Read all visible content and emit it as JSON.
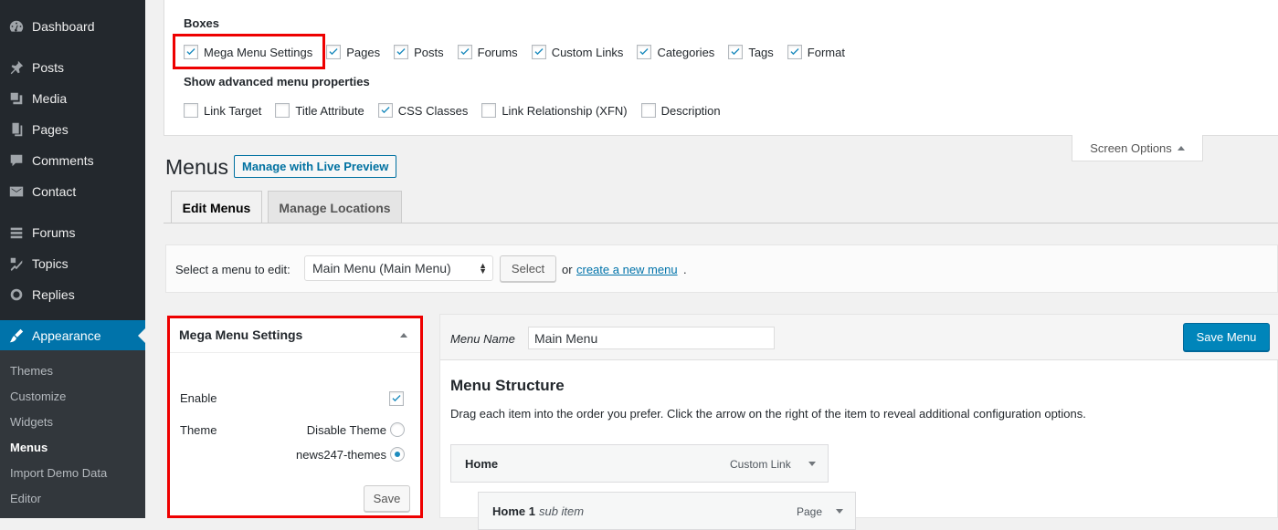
{
  "sidebar": {
    "items": [
      {
        "label": "Dashboard",
        "icon": "dashboard-icon"
      },
      {
        "label": "Posts",
        "icon": "pin-icon"
      },
      {
        "label": "Media",
        "icon": "media-icon"
      },
      {
        "label": "Pages",
        "icon": "pages-icon"
      },
      {
        "label": "Comments",
        "icon": "comment-icon"
      },
      {
        "label": "Contact",
        "icon": "mail-icon"
      },
      {
        "label": "Forums",
        "icon": "forums-icon"
      },
      {
        "label": "Topics",
        "icon": "topics-icon"
      },
      {
        "label": "Replies",
        "icon": "replies-icon"
      },
      {
        "label": "Appearance",
        "icon": "brush-icon"
      }
    ],
    "submenu": [
      "Themes",
      "Customize",
      "Widgets",
      "Menus",
      "Import Demo Data",
      "Editor"
    ],
    "current_submenu": "Menus"
  },
  "screen_options": {
    "boxes_title": "Boxes",
    "boxes": [
      {
        "label": "Mega Menu Settings",
        "checked": true
      },
      {
        "label": "Pages",
        "checked": true
      },
      {
        "label": "Posts",
        "checked": true
      },
      {
        "label": "Forums",
        "checked": true
      },
      {
        "label": "Custom Links",
        "checked": true
      },
      {
        "label": "Categories",
        "checked": true
      },
      {
        "label": "Tags",
        "checked": true
      },
      {
        "label": "Format",
        "checked": true
      }
    ],
    "advanced_title": "Show advanced menu properties",
    "advanced": [
      {
        "label": "Link Target",
        "checked": false
      },
      {
        "label": "Title Attribute",
        "checked": false
      },
      {
        "label": "CSS Classes",
        "checked": true
      },
      {
        "label": "Link Relationship (XFN)",
        "checked": false
      },
      {
        "label": "Description",
        "checked": false
      }
    ],
    "tab_label": "Screen Options"
  },
  "page": {
    "title": "Menus",
    "live_preview": "Manage with Live Preview",
    "tabs": [
      "Edit Menus",
      "Manage Locations"
    ]
  },
  "select_bar": {
    "label": "Select a menu to edit:",
    "selected": "Main Menu (Main Menu)",
    "button": "Select",
    "or": "or",
    "create_link": "create a new menu",
    "period": "."
  },
  "mega_settings": {
    "title": "Mega Menu Settings",
    "enable_label": "Enable",
    "enable_checked": true,
    "theme_label": "Theme",
    "theme_options": [
      {
        "label": "Disable Theme",
        "selected": false
      },
      {
        "label": "news247-themes",
        "selected": true
      }
    ],
    "save": "Save"
  },
  "menu_editor": {
    "name_label": "Menu Name",
    "name_value": "Main Menu",
    "save_button": "Save Menu",
    "structure_title": "Menu Structure",
    "structure_desc": "Drag each item into the order you prefer. Click the arrow on the right of the item to reveal additional configuration options.",
    "items": [
      {
        "title": "Home",
        "subtitle": "",
        "type": "Custom Link"
      },
      {
        "title": "Home 1",
        "subtitle": "sub item",
        "type": "Page"
      }
    ]
  },
  "colors": {
    "sidebar_bg": "#23282d",
    "accent": "#0073aa",
    "highlight": "#e00000",
    "primary_button": "#0085ba"
  }
}
